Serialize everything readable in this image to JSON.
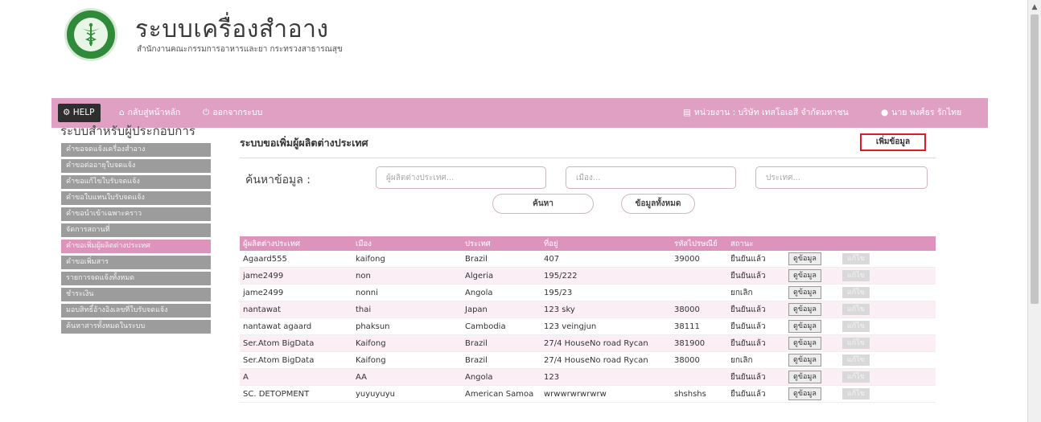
{
  "header": {
    "title": "ระบบเครื่องสำอาง",
    "subtitle": "สำนักงานคณะกรรมการอาหารและยา กระทรวงสาธารณสุข"
  },
  "navbar": {
    "help": "HELP",
    "home": "กลับสู่หน้าหลัก",
    "logout": "ออกจากระบบ",
    "agency": "หน่วยงาน : บริษัท เทสโอเอสี จำกัดมหาชน",
    "user": "นาย พงศ์ธร รักไทย"
  },
  "sidebar": {
    "title": "ระบบสำหรับผู้ประกอบการ",
    "items": [
      {
        "label": "คำขอจดแจ้งเครื่องสำอาง",
        "active": false
      },
      {
        "label": "คำขอต่ออายุใบจดแจ้ง",
        "active": false
      },
      {
        "label": "คำขอแก้ไขใบรับจดแจ้ง",
        "active": false
      },
      {
        "label": "คำขอใบแทนใบรับจดแจ้ง",
        "active": false
      },
      {
        "label": "คำขอนำเข้าเฉพาะคราว",
        "active": false
      },
      {
        "label": "จัดการสถานที่",
        "active": false
      },
      {
        "label": "คำขอเพิ่มผู้ผลิตต่างประเทศ",
        "active": true
      },
      {
        "label": "คำขอเพิ่มสาร",
        "active": false
      },
      {
        "label": "รายการจดแจ้งทั้งหมด",
        "active": false
      },
      {
        "label": "ชำระเงิน",
        "active": false
      },
      {
        "label": "มอบสิทธิ์อ้างอิงเลขที่ใบรับจดแจ้ง",
        "active": false
      },
      {
        "label": "ค้นหาสารทั้งหมดในระบบ",
        "active": false
      }
    ]
  },
  "main": {
    "title": "ระบบขอเพิ่มผู้ผลิตต่างประเทศ",
    "add_button": "เพิ่มข้อมูล",
    "search_label": "ค้นหาข้อมูล :",
    "manufacturer_placeholder": "ผู้ผลิตต่างประเทศ...",
    "city_placeholder": "เมือง...",
    "country_placeholder": "ประเทศ...",
    "search_button": "ค้นหา",
    "all_button": "ข้อมูลทั้งหมด"
  },
  "table": {
    "headers": [
      "ผู้ผลิตต่างประเทศ",
      "เมือง",
      "ประเทศ",
      "ที่อยู่",
      "รหัสไปรษณีย์",
      "สถานะ",
      "",
      ""
    ],
    "view_label": "ดูข้อมูล",
    "edit_label": "แก้ไข",
    "rows": [
      {
        "manufacturer": "Agaard555",
        "city": "kaifong",
        "country": "Brazil",
        "address": "407",
        "zip": "39000",
        "status": "ยืนยันแล้ว"
      },
      {
        "manufacturer": "jame2499",
        "city": "non",
        "country": "Algeria",
        "address": "195/222",
        "zip": "",
        "status": "ยืนยันแล้ว"
      },
      {
        "manufacturer": "jame2499",
        "city": "nonni",
        "country": "Angola",
        "address": "195/23",
        "zip": "",
        "status": "ยกเลิก"
      },
      {
        "manufacturer": "nantawat",
        "city": "thai",
        "country": "Japan",
        "address": "123 sky",
        "zip": "38000",
        "status": "ยืนยันแล้ว"
      },
      {
        "manufacturer": "nantawat agaard",
        "city": "phaksun",
        "country": "Cambodia",
        "address": "123 veingjun",
        "zip": "38111",
        "status": "ยืนยันแล้ว"
      },
      {
        "manufacturer": "Ser.Atom BigData",
        "city": "Kaifong",
        "country": "Brazil",
        "address": "27/4 HouseNo road Rycan",
        "zip": "381900",
        "status": "ยืนยันแล้ว"
      },
      {
        "manufacturer": "Ser.Atom BigData",
        "city": "Kaifong",
        "country": "Brazil",
        "address": "27/4 HouseNo road Rycan",
        "zip": "38000",
        "status": "ยกเลิก"
      },
      {
        "manufacturer": "A",
        "city": "AA",
        "country": "Angola",
        "address": "123",
        "zip": "",
        "status": "ยืนยันแล้ว"
      },
      {
        "manufacturer": "SC. DETOPMENT",
        "city": "yuyuyuyu",
        "country": "American Samoa",
        "address": "wrwwrwrwrwrw",
        "zip": "shshshs",
        "status": "ยืนยันแล้ว"
      }
    ]
  },
  "colors": {
    "navbar": "#e0a0c4",
    "table_header": "#de93bd",
    "sidebar_item": "#9c9c9c",
    "sidebar_active": "#de93bd",
    "add_button_border": "#e01b24"
  }
}
